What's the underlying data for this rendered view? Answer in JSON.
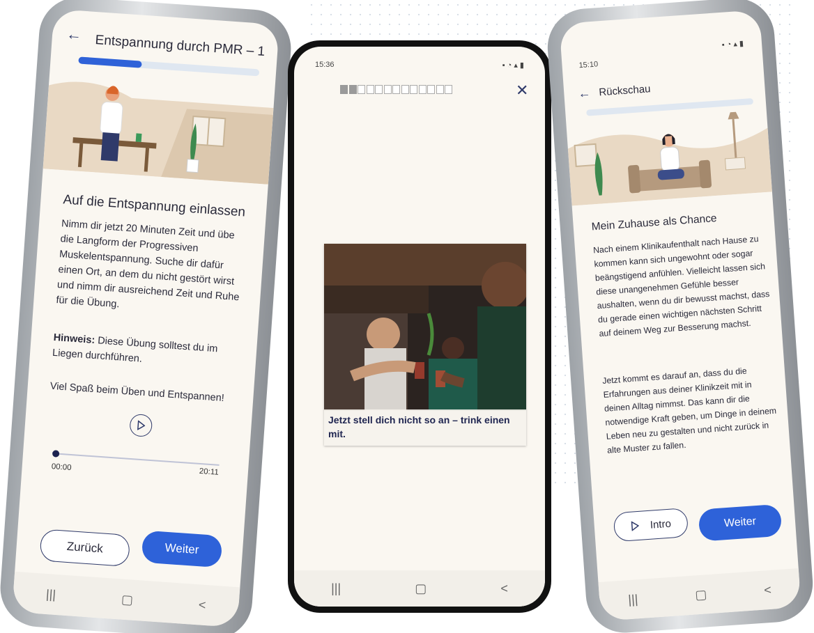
{
  "phone1": {
    "title": "Entspannung durch PMR – 1",
    "progress": 0.35,
    "heading": "Auf die Entspannung einlassen",
    "body": "Nimm dir jetzt 20 Minuten Zeit und übe die Langform der Progressiven Muskelentspannung. Suche dir dafür einen Ort, an dem du nicht gestört wirst und nimm dir ausreichend Zeit und Ruhe für die Übung.",
    "hint_label": "Hinweis:",
    "hint_text": "Diese Übung solltest du im Liegen durchführen.",
    "closing": "Viel Spaß beim Üben und Entspannen!",
    "time_start": "00:00",
    "time_end": "20:11",
    "back_button": "Zurück",
    "next_button": "Weiter",
    "nav": [
      "|||",
      "▢",
      "<"
    ]
  },
  "phone2": {
    "status_time": "15:36",
    "steps_total": 13,
    "steps_done": 2,
    "caption": "Jetzt stell dich nicht so an – trink einen mit.",
    "nav": [
      "|||",
      "▢",
      "<"
    ]
  },
  "phone3": {
    "status_time": "15:10",
    "title": "Rückschau",
    "heading": "Mein Zuhause als Chance",
    "para1": "Nach einem Klinikaufenthalt nach Hause zu kommen kann sich ungewohnt oder sogar beängstigend anfühlen. Vielleicht lassen sich diese unangenehmen Gefühle besser aushalten, wenn du dir bewusst machst, dass du gerade einen wichtigen nächsten Schritt auf deinem Weg zur Besserung machst.",
    "para2": "Jetzt kommt es darauf an, dass du die Erfahrungen aus deiner Klinikzeit mit in deinen Alltag nimmst. Das kann dir die notwendige Kraft geben, um Dinge in deinem Leben neu zu gestalten und nicht zurück in alte Muster zu fallen.",
    "intro_button": "Intro",
    "next_button": "Weiter",
    "nav": [
      "|||",
      "▢",
      "<"
    ]
  },
  "colors": {
    "primary": "#2e62d9",
    "dark_text": "#2a2a3a",
    "screen_bg": "#faf7f1",
    "illustration_sand": "#e9d9c4"
  }
}
